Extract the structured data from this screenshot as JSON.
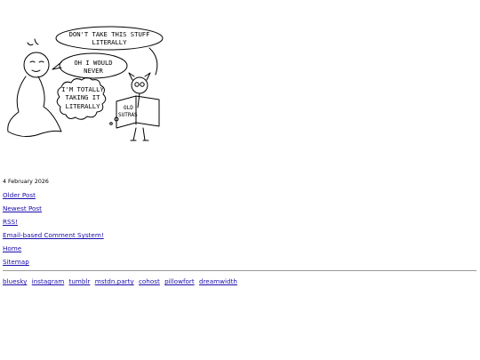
{
  "comic": {
    "bubble_top": [
      "DON'T TAKE THIS STUFF",
      "LITERALLY"
    ],
    "bubble_mid": [
      "OH I WOULD",
      "NEVER"
    ],
    "bubble_think": [
      "I'M TOTALLY",
      "TAKING IT",
      "LITERALLY"
    ],
    "book_label": [
      "OLD",
      "SUTRAS"
    ]
  },
  "post": {
    "date": "4 February 2026"
  },
  "nav": {
    "older": "Older Post",
    "newest": "Newest Post",
    "rss": "RSS!",
    "comments": "Email-based Comment System!",
    "home": "Home",
    "sitemap": "Sitemap"
  },
  "social": [
    "bluesky",
    "instagram",
    "tumblr",
    "mstdn.party",
    "cohost",
    "pillowfort",
    "dreamwidth"
  ]
}
